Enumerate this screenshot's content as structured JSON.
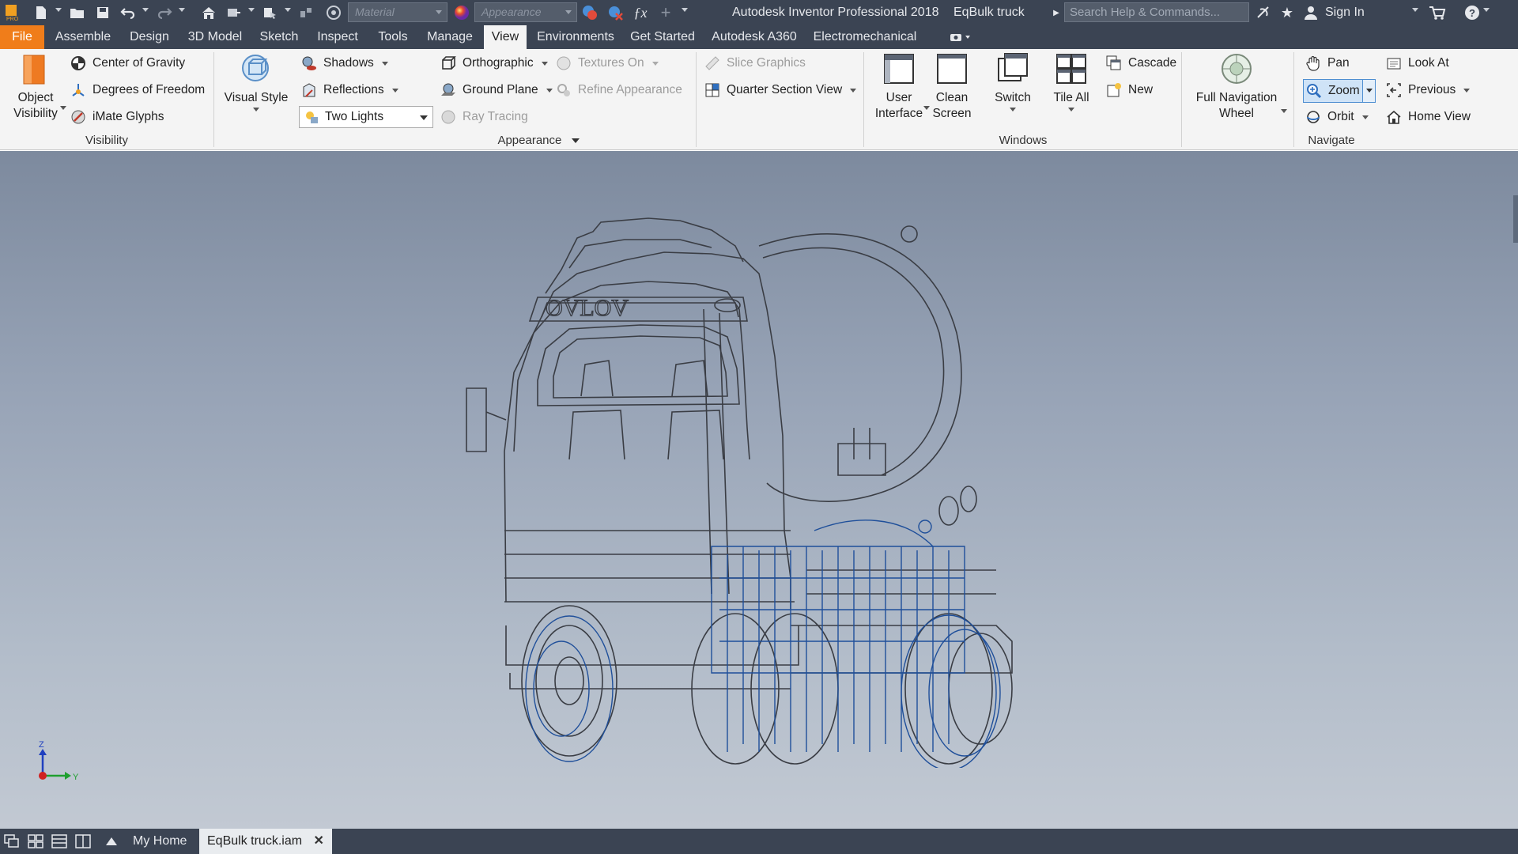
{
  "titlebar": {
    "material_placeholder": "Material",
    "appearance_placeholder": "Appearance",
    "app_title": "Autodesk Inventor Professional 2018",
    "doc_title": "EqBulk truck",
    "search_placeholder": "Search Help & Commands...",
    "sign_in": "Sign In",
    "icons": [
      "inventor-logo-icon",
      "new-icon",
      "open-icon",
      "save-icon",
      "undo-icon",
      "redo-icon",
      "home-icon",
      "return-icon",
      "select-icon",
      "measure-icon",
      "color-icon",
      "appearance-adjust-icon",
      "clear-appearance-icon",
      "fx-icon",
      "plus-icon",
      "customize-icon",
      "comms-icon",
      "star-icon",
      "user-icon",
      "cart-icon",
      "help-icon"
    ]
  },
  "tabs": {
    "file": "File",
    "items": [
      "Assemble",
      "Design",
      "3D Model",
      "Sketch",
      "Inspect",
      "Tools",
      "Manage",
      "View",
      "Environments",
      "Get Started",
      "Autodesk A360",
      "Electromechanical"
    ],
    "active": "View"
  },
  "ribbon": {
    "visibility": {
      "title": "Visibility",
      "object_visibility": "Object\nVisibility",
      "object_visibility_l1": "Object",
      "object_visibility_l2": "Visibility",
      "center_of_gravity": "Center of Gravity",
      "degrees_of_freedom": "Degrees of Freedom",
      "imate_glyphs": "iMate Glyphs"
    },
    "appearance": {
      "title": "Appearance",
      "visual_style": "Visual Style",
      "shadows": "Shadows",
      "reflections": "Reflections",
      "lights_value": "Two Lights",
      "orthographic": "Orthographic",
      "ground_plane": "Ground Plane",
      "ray_tracing": "Ray Tracing",
      "textures_on": "Textures On",
      "refine_appearance": "Refine Appearance",
      "slice_graphics": "Slice Graphics",
      "quarter_section_view": "Quarter Section View"
    },
    "windows": {
      "title": "Windows",
      "user_interface_l1": "User",
      "user_interface_l2": "Interface",
      "clean_screen_l1": "Clean",
      "clean_screen_l2": "Screen",
      "switch": "Switch",
      "tile_all": "Tile All",
      "cascade": "Cascade",
      "new": "New"
    },
    "navigate": {
      "title": "Navigate",
      "full_nav_l1": "Full Navigation",
      "full_nav_l2": "Wheel",
      "pan": "Pan",
      "zoom": "Zoom",
      "orbit": "Orbit",
      "look_at": "Look At",
      "previous": "Previous",
      "home_view": "Home View"
    }
  },
  "viewport": {
    "axis_z": "Z",
    "axis_y": "Y",
    "grille_text": "OVLOV",
    "colors": {
      "wire": "#3a3d44",
      "highlight": "#1f4f9a",
      "background_top": "#7d8a9e",
      "background_bottom": "#c2c9d3"
    }
  },
  "docbar": {
    "my_home": "My Home",
    "active_doc": "EqBulk truck.iam",
    "close": "✕"
  },
  "colors": {
    "file_tab": "#f07d1a",
    "titlebar": "#3b4453",
    "ribbon": "#f4f4f4",
    "zoom_active": "#cfe3f7"
  }
}
